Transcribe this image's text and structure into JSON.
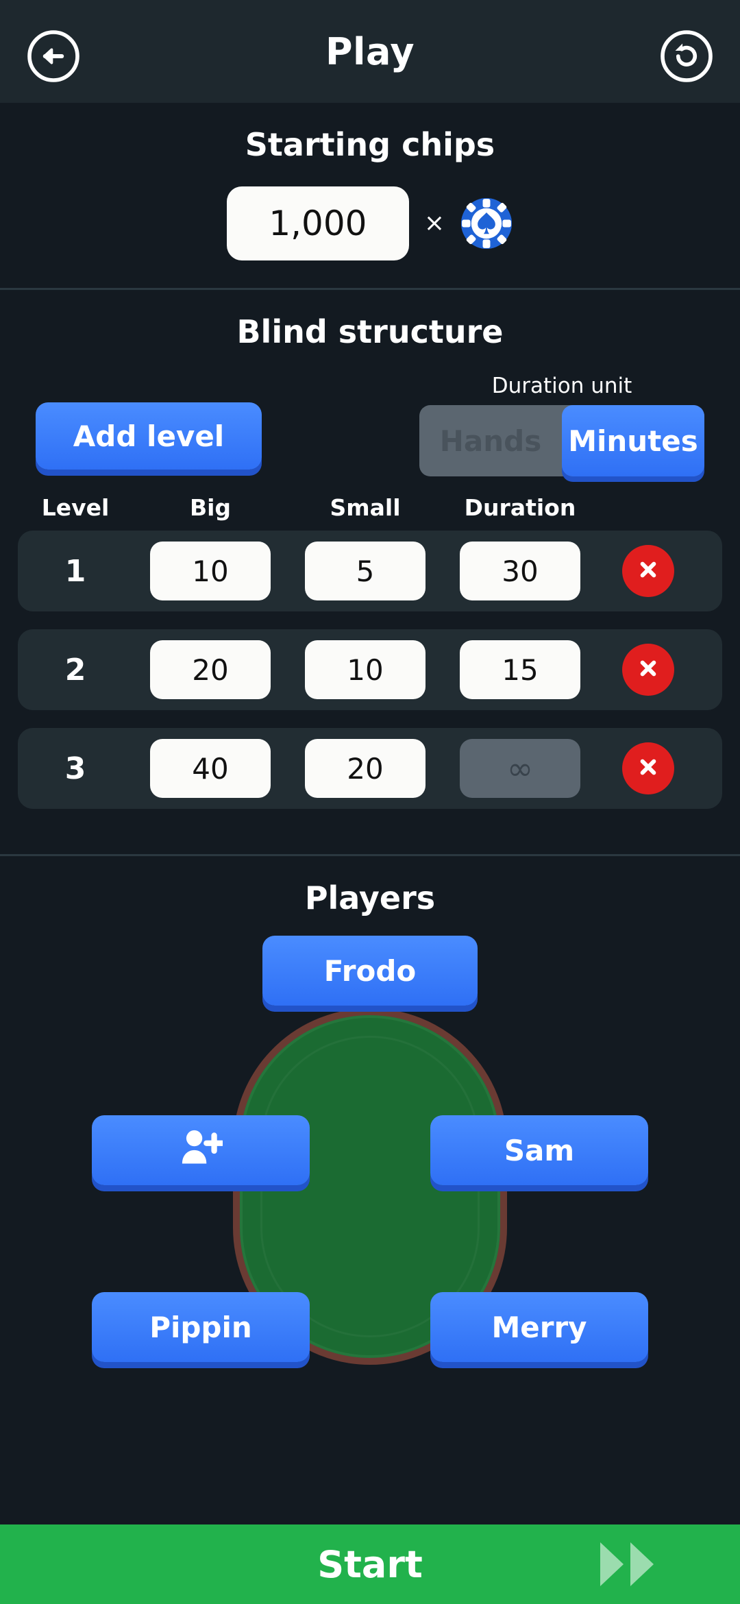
{
  "header": {
    "title": "Play",
    "back_icon": "arrow-left-circle-icon",
    "reset_icon": "reset-circle-icon"
  },
  "starting_chips": {
    "title": "Starting chips",
    "value": "1,000",
    "times": "×",
    "chip_icon": "poker-chip-icon",
    "chip_color": "#1f63d6"
  },
  "blind_structure": {
    "title": "Blind structure",
    "add_level_label": "Add level",
    "duration_unit_label": "Duration unit",
    "unit_options": [
      "Hands",
      "Minutes"
    ],
    "unit_selected": "Minutes",
    "columns": [
      "Level",
      "Big",
      "Small",
      "Duration"
    ],
    "rows": [
      {
        "level": "1",
        "big": "10",
        "small": "5",
        "duration": "30",
        "duration_disabled": false,
        "delete_icon": "close-circle-icon"
      },
      {
        "level": "2",
        "big": "20",
        "small": "10",
        "duration": "15",
        "duration_disabled": false,
        "delete_icon": "close-circle-icon"
      },
      {
        "level": "3",
        "big": "40",
        "small": "20",
        "duration": "∞",
        "duration_disabled": true,
        "delete_icon": "close-circle-icon"
      }
    ]
  },
  "players": {
    "title": "Players",
    "seats": [
      {
        "label": "Frodo",
        "position": "top",
        "is_add": false
      },
      {
        "label": "",
        "position": "left-middle",
        "is_add": true,
        "icon": "person-add-icon"
      },
      {
        "label": "Sam",
        "position": "right-middle",
        "is_add": false
      },
      {
        "label": "Pippin",
        "position": "left-bottom",
        "is_add": false
      },
      {
        "label": "Merry",
        "position": "right-bottom",
        "is_add": false
      }
    ]
  },
  "start_bar": {
    "label": "Start",
    "icon": "fast-forward-icon",
    "color": "#22b24c"
  },
  "theme": {
    "background": "#131a21",
    "header_background": "#1e282e",
    "row_background": "#222d33",
    "accent_blue": "#2f70f5",
    "accent_blue_shadow": "#2253c9",
    "danger_red": "#e01e1e",
    "felt_green": "#1b6b32",
    "rail_brown": "#6a3b33",
    "muted_gray": "#5b6670"
  }
}
